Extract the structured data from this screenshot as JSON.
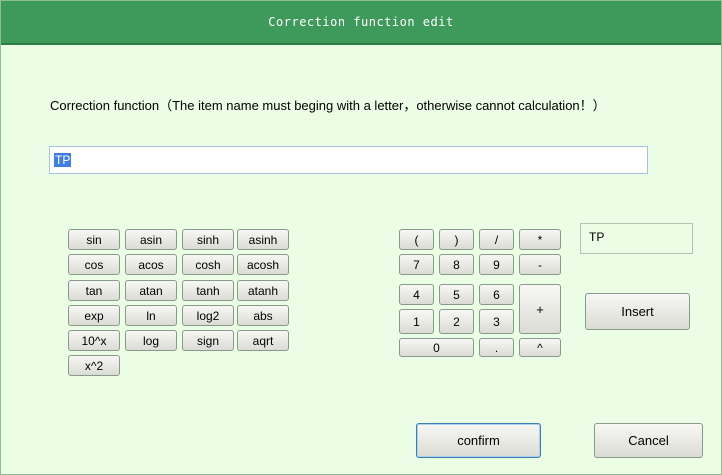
{
  "dialog": {
    "title": "Correction function edit",
    "instruction": "Correction function（The item name must beging with a letter，otherwise cannot calculation！）",
    "expression_value": "TP",
    "readout_value": "TP"
  },
  "functions": {
    "sin": "sin",
    "asin": "asin",
    "sinh": "sinh",
    "asinh": "asinh",
    "cos": "cos",
    "acos": "acos",
    "cosh": "cosh",
    "acosh": "acosh",
    "tan": "tan",
    "atan": "atan",
    "tanh": "tanh",
    "atanh": "atanh",
    "exp": "exp",
    "ln": "ln",
    "log2": "log2",
    "abs": "abs",
    "pow10": "10^x",
    "log": "log",
    "sign": "sign",
    "sqrt": "aqrt",
    "square": "x^2"
  },
  "keypad": {
    "lparen": "(",
    "rparen": ")",
    "divide": "/",
    "multiply": "*",
    "seven": "7",
    "eight": "8",
    "nine": "9",
    "minus": "-",
    "four": "4",
    "five": "5",
    "six": "6",
    "plus": "+",
    "one": "1",
    "two": "2",
    "three": "3",
    "zero": "0",
    "dot": ".",
    "caret": "^"
  },
  "actions": {
    "insert": "Insert",
    "confirm": "confirm",
    "cancel": "Cancel"
  }
}
